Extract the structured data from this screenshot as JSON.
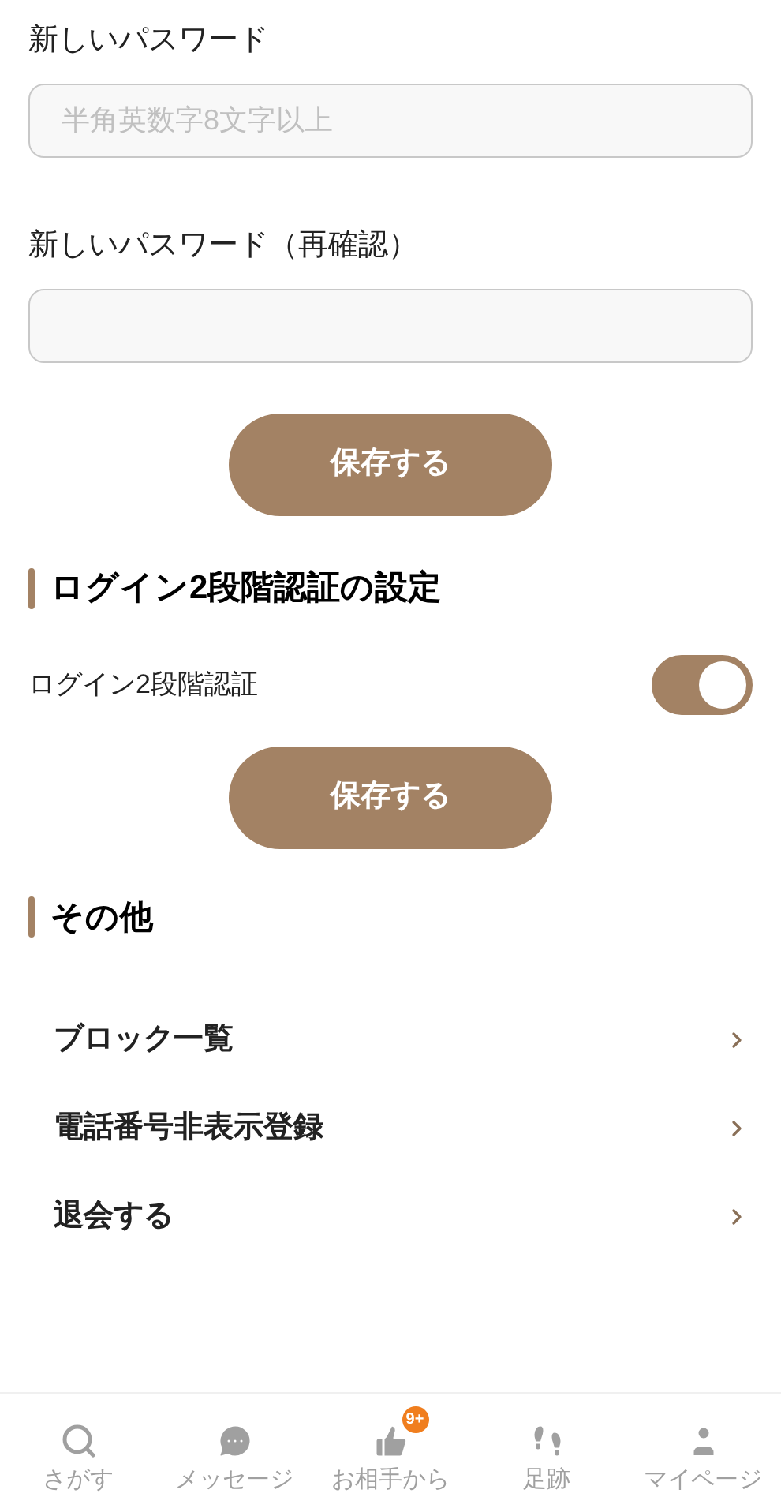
{
  "password_fields": [
    {
      "label": "新しいパスワード",
      "placeholder": "半角英数字8文字以上"
    },
    {
      "label": "新しいパスワード（再確認）"
    }
  ],
  "save_buttons": [
    "保存する",
    "保存する"
  ],
  "two_factor": {
    "heading": "ログイン2段階認証の設定",
    "label": "ログイン2段階認証",
    "on": true
  },
  "other": {
    "heading": "その他",
    "items": [
      "ブロック一覧",
      "電話番号非表示登録",
      "退会する"
    ]
  },
  "bottom_nav": [
    {
      "kind": "search",
      "label": "さがす",
      "selected": false
    },
    {
      "kind": "message",
      "label": "メッセージ",
      "selected": false
    },
    {
      "kind": "like",
      "label": "お相手から",
      "selected": false,
      "badge": "9+"
    },
    {
      "kind": "footprints",
      "label": "足跡",
      "selected": false
    },
    {
      "kind": "user",
      "label": "マイページ",
      "selected": false
    }
  ]
}
